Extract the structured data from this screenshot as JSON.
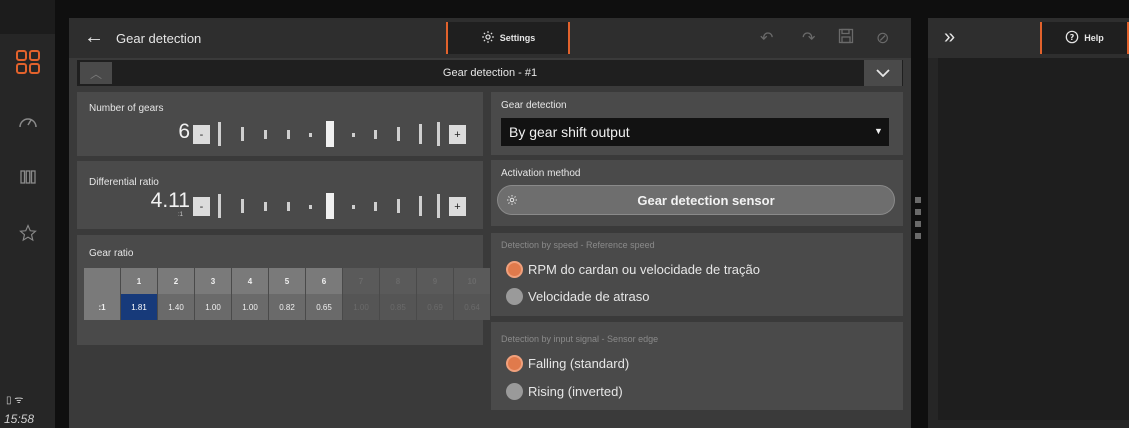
{
  "status": {
    "clock": "15:58",
    "icons": [
      "battery-icon",
      "wifi-icon"
    ]
  },
  "header": {
    "back_icon": "arrow-left-icon",
    "title": "Gear detection",
    "settings_tab": "Settings",
    "settings_icon": "gear-icon",
    "action_icons": [
      "undo-icon",
      "redo-icon",
      "save-icon",
      "cancel-icon"
    ]
  },
  "instance": {
    "label": "Gear detection - #1"
  },
  "number_of_gears": {
    "label": "Number of gears",
    "value": "6",
    "minus": "-",
    "plus": "+"
  },
  "differential_ratio": {
    "label": "Differential ratio",
    "value": "4.11",
    "unit": ":1",
    "minus": "-",
    "plus": "+"
  },
  "gear_ratio": {
    "label": "Gear ratio",
    "columns": [
      "",
      "1",
      "2",
      "3",
      "4",
      "5",
      "6",
      "7",
      "8",
      "9",
      "10"
    ],
    "row_label": ":1",
    "values": [
      "1.81",
      "1.40",
      "1.00",
      "1.00",
      "0.82",
      "0.65",
      "1.00",
      "0.85",
      "0.69",
      "0.64"
    ],
    "selected_index": 0,
    "active_count": 6
  },
  "gear_detection": {
    "label": "Gear detection",
    "selected": "By gear shift output"
  },
  "activation": {
    "label": "Activation method",
    "button": "Gear detection sensor"
  },
  "speed_detection": {
    "label": "Detection by speed - Reference speed",
    "options": [
      "RPM do cardan ou velocidade de tração",
      "Velocidade de atraso"
    ],
    "selected_index": 0
  },
  "signal_detection": {
    "label": "Detection by input signal - Sensor edge",
    "options": [
      "Falling (standard)",
      "Rising (inverted)"
    ],
    "selected_index": 0
  },
  "help": {
    "tab": "Help",
    "icon": "question-circle-icon",
    "expand_icon": "double-chevron-right-icon"
  },
  "colors": {
    "accent": "#e2622c",
    "selected_cell": "#173a7a",
    "radio_on": "#e07a4c"
  }
}
